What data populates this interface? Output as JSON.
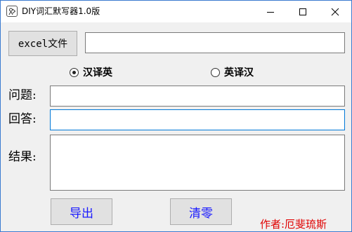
{
  "window": {
    "title": "DIY词汇默写器1.0版",
    "icon": "app-icon"
  },
  "file": {
    "button_label": "excel文件",
    "path_value": ""
  },
  "mode": {
    "options": [
      {
        "label": "汉译英",
        "checked": true
      },
      {
        "label": "英译汉",
        "checked": false
      }
    ]
  },
  "fields": {
    "question_label": "问题:",
    "question_value": "",
    "answer_label": "回答:",
    "answer_value": "",
    "result_label": "结果:",
    "result_value": ""
  },
  "actions": {
    "export_label": "导出",
    "clear_label": "清零"
  },
  "author": "作者:厄斐琉斯",
  "colors": {
    "action_text": "#1a1aff",
    "author_text": "#e00000",
    "focus_border": "#0078d7"
  }
}
